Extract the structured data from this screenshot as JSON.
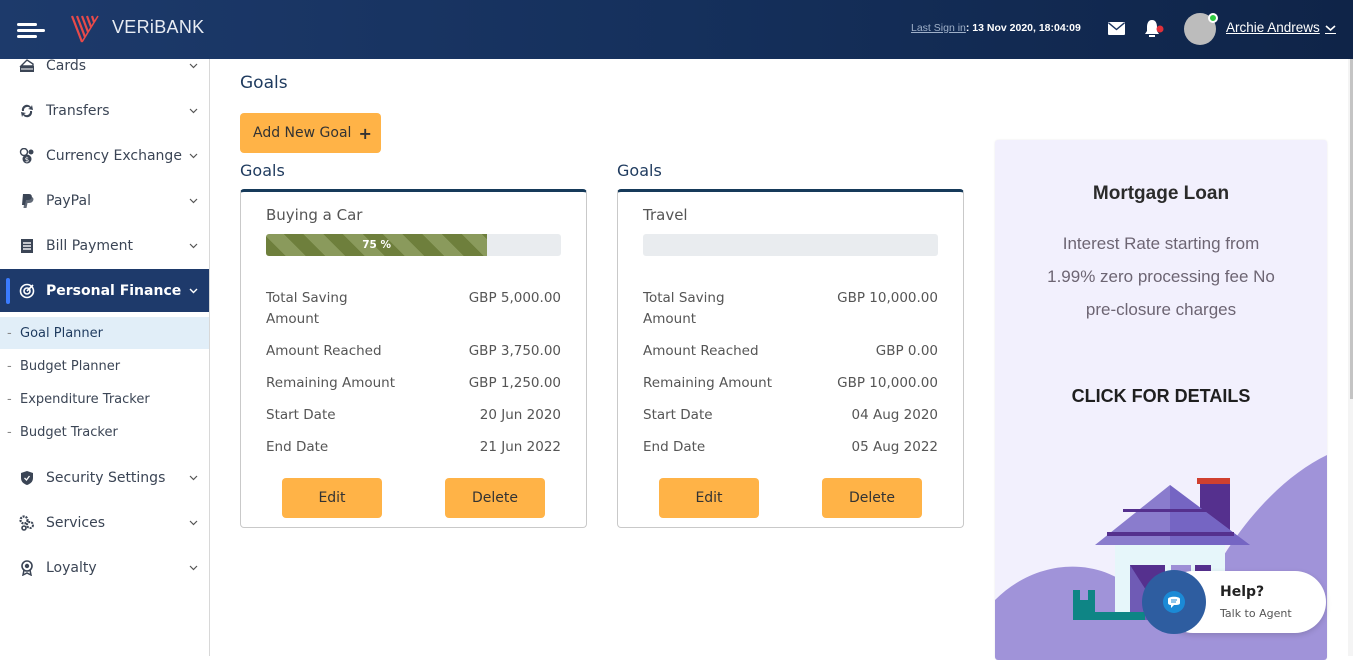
{
  "header": {
    "brand": "VERiBANK",
    "last_sign_in_label": "Last Sign in",
    "last_sign_in_value": ": 13 Nov 2020, 18:04:09",
    "user_name": "Archie Andrews",
    "notification_badge_color": "#e0303a",
    "online_status_color": "#2ecc40"
  },
  "sidebar": {
    "items": [
      {
        "label": "Cards",
        "icon": "card-icon"
      },
      {
        "label": "Transfers",
        "icon": "transfer-icon"
      },
      {
        "label": "Currency Exchange",
        "icon": "currency-exchange-icon"
      },
      {
        "label": "PayPal",
        "icon": "paypal-icon"
      },
      {
        "label": "Bill Payment",
        "icon": "bill-icon"
      },
      {
        "label": "Personal Finance",
        "icon": "target-icon"
      },
      {
        "label": "Security Settings",
        "icon": "shield-icon"
      },
      {
        "label": "Services",
        "icon": "gears-icon"
      },
      {
        "label": "Loyalty",
        "icon": "award-icon"
      }
    ],
    "sub_items": [
      {
        "label": "Goal Planner"
      },
      {
        "label": "Budget Planner"
      },
      {
        "label": "Expenditure Tracker"
      },
      {
        "label": "Budget Tracker"
      }
    ],
    "sub_dash": "-"
  },
  "main": {
    "title": "Goals",
    "add_button": "Add New Goal",
    "add_icon": "+",
    "goals": [
      {
        "heading": "Goals",
        "name": "Buying a Car",
        "progress_percent": 75,
        "progress_label": "75 %",
        "total_label": "Total Saving Amount",
        "total_value": "GBP 5,000.00",
        "reached_label": "Amount Reached",
        "reached_value": "GBP 3,750.00",
        "remaining_label": "Remaining Amount",
        "remaining_value": "GBP 1,250.00",
        "start_label": "Start Date",
        "start_value": "20 Jun 2020",
        "end_label": "End Date",
        "end_value": "21 Jun 2022",
        "edit": "Edit",
        "delete": "Delete"
      },
      {
        "heading": "Goals",
        "name": "Travel",
        "progress_percent": 0,
        "progress_label": "",
        "total_label": "Total Saving Amount",
        "total_value": "GBP 10,000.00",
        "reached_label": "Amount Reached",
        "reached_value": "GBP 0.00",
        "remaining_label": "Remaining Amount",
        "remaining_value": "GBP 10,000.00",
        "start_label": "Start Date",
        "start_value": "04 Aug 2020",
        "end_label": "End Date",
        "end_value": "05 Aug 2022",
        "edit": "Edit",
        "delete": "Delete"
      }
    ]
  },
  "promo": {
    "title": "Mortgage Loan",
    "text": "Interest Rate starting from 1.99% zero processing fee No pre-closure charges",
    "cta": "CLICK FOR DETAILS"
  },
  "help": {
    "title": "Help?",
    "subtitle": "Talk to Agent"
  },
  "colors": {
    "accent_button": "#ffb347",
    "header_bg": "#1d3a6b",
    "active_nav_bg": "#1e3a6b",
    "progress_fill": "#6e7f3c"
  }
}
